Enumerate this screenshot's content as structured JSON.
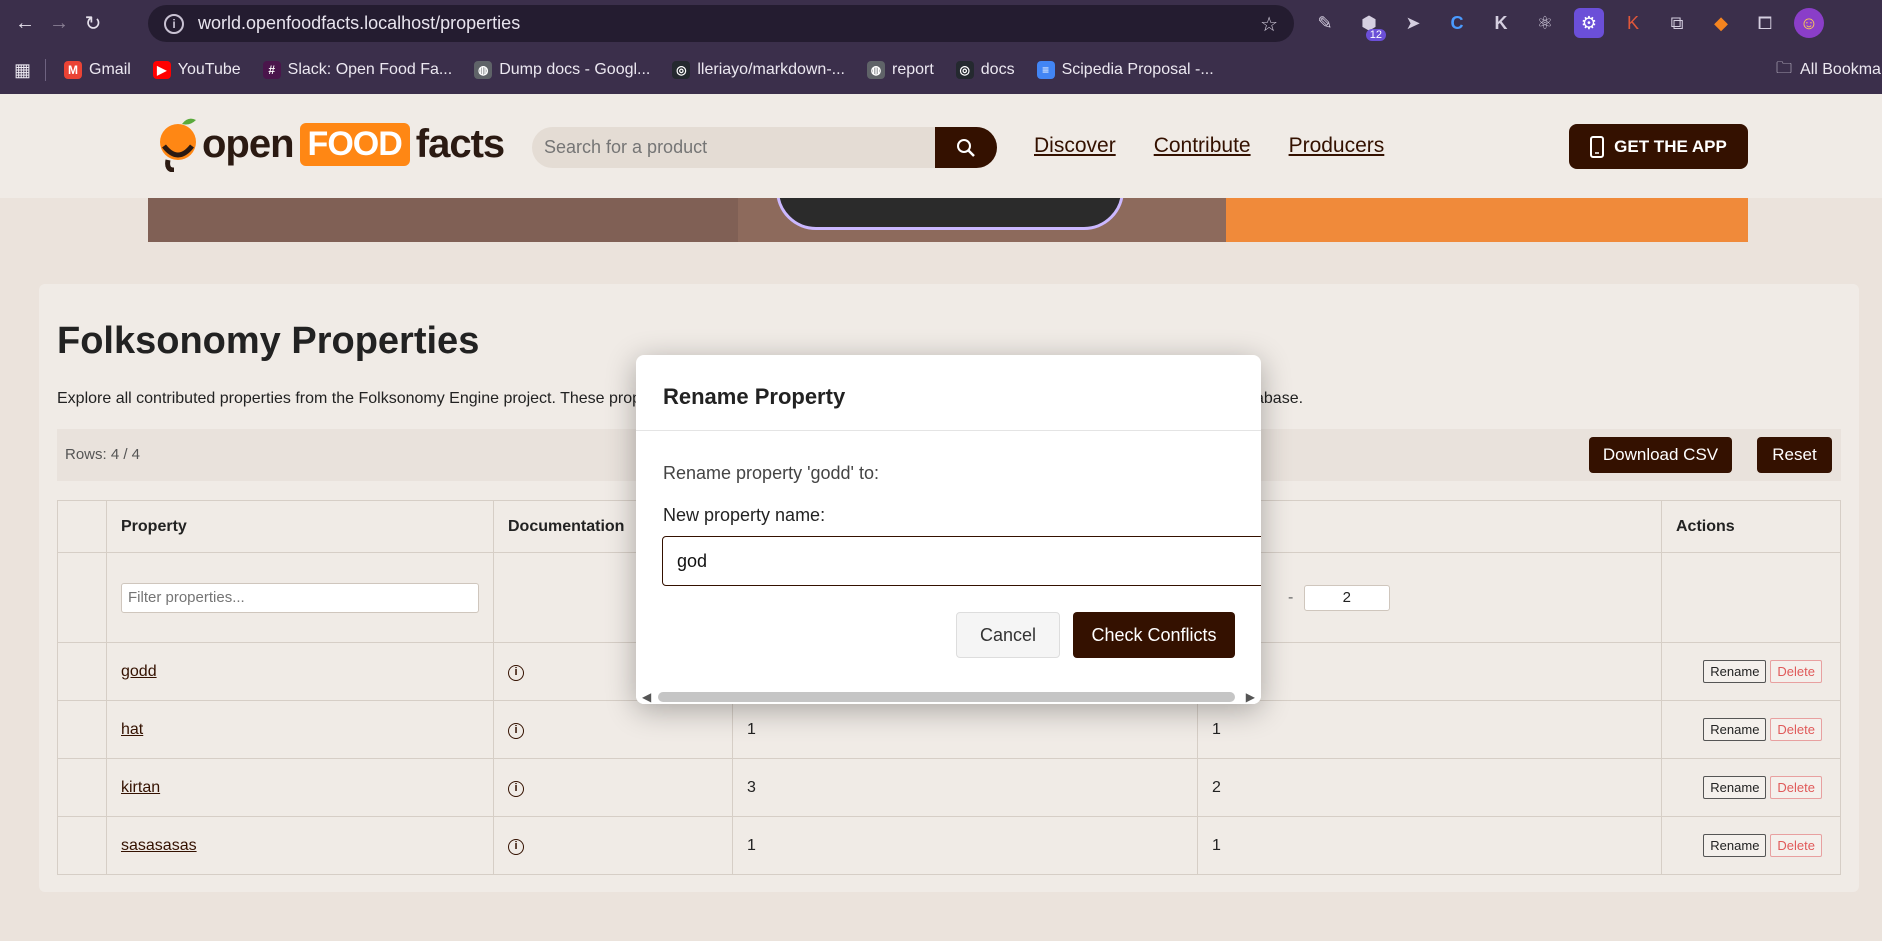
{
  "browser": {
    "url": "world.openfoodfacts.localhost/properties",
    "bookmarks": [
      {
        "label": "Gmail",
        "color": "#ea4335",
        "glyph": "M"
      },
      {
        "label": "YouTube",
        "color": "#ff0000",
        "glyph": "▶"
      },
      {
        "label": "Slack: Open Food Fa...",
        "color": "#4a154b",
        "glyph": "#"
      },
      {
        "label": "Dump docs - Googl...",
        "color": "#5f6368",
        "glyph": "◍"
      },
      {
        "label": "lleriayo/markdown-...",
        "color": "#24292f",
        "glyph": "◎"
      },
      {
        "label": "report",
        "color": "#5f6368",
        "glyph": "◍"
      },
      {
        "label": "docs",
        "color": "#24292f",
        "glyph": "◎"
      },
      {
        "label": "Scipedia Proposal -...",
        "color": "#4285f4",
        "glyph": "≡"
      }
    ],
    "all_bookmarks": "All Bookmarks",
    "ext_badge": "12"
  },
  "site": {
    "logo_open": "open",
    "logo_food": "FOOD",
    "logo_facts": "facts",
    "search_placeholder": "Search for a product",
    "nav": [
      "Discover",
      "Contribute",
      "Producers"
    ],
    "get_app": "GET THE APP"
  },
  "page": {
    "title": "Folksonomy Properties",
    "description": "Explore all contributed properties from the Folksonomy Engine project. These prope",
    "description_end": "abase.",
    "rows": "Rows: 4 / 4",
    "download_csv": "Download CSV",
    "reset": "Reset",
    "columns": {
      "property": "Property",
      "documentation": "Documentation",
      "actions": "Actions"
    },
    "filter_placeholder": "Filter properties...",
    "range_sep": "-",
    "range_max": "2",
    "rows_data": [
      {
        "property": "godd",
        "col3": "",
        "col4": ""
      },
      {
        "property": "hat",
        "col3": "1",
        "col4": "1"
      },
      {
        "property": "kirtan",
        "col3": "3",
        "col4": "2"
      },
      {
        "property": "sasasasas",
        "col3": "1",
        "col4": "1"
      }
    ],
    "rename_label": "Rename",
    "delete_label": "Delete"
  },
  "modal": {
    "title": "Rename Property",
    "prompt": "Rename property 'godd' to:",
    "label": "New property name:",
    "value": "god",
    "cancel": "Cancel",
    "check": "Check Conflicts"
  }
}
